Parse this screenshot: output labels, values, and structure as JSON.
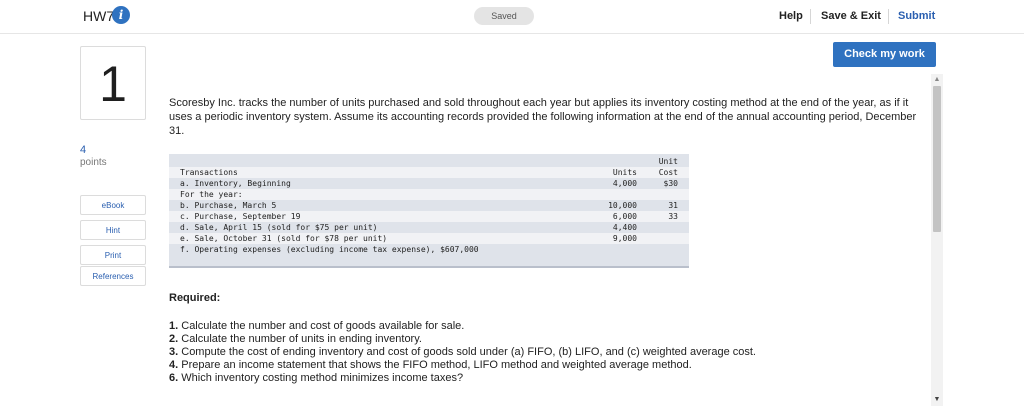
{
  "header": {
    "title": "HW7",
    "info_glyph": "i",
    "saved_label": "Saved",
    "help_label": "Help",
    "save_exit_label": "Save & Exit",
    "submit_label": "Submit"
  },
  "check_work_label": "Check my work",
  "question": {
    "number": "1",
    "points_value": "4",
    "points_label": "points",
    "text": "Scoresby Inc. tracks the number of units purchased and sold throughout each year but applies its inventory costing method at the end of the year, as if it uses a periodic inventory system. Assume its accounting records provided the following information at the end of the annual accounting period, December 31."
  },
  "sidebar": {
    "ebook": "eBook",
    "hint": "Hint",
    "print": "Print",
    "references": "References"
  },
  "table": {
    "header_unit": "Unit",
    "header_transactions": "Transactions",
    "header_units": "Units",
    "header_cost": "Cost",
    "rows": [
      {
        "desc": "a. Inventory, Beginning",
        "units": "4,000",
        "cost": "$30"
      },
      {
        "desc": "For the year:",
        "units": "",
        "cost": ""
      },
      {
        "desc": "b. Purchase, March 5",
        "units": "10,000",
        "cost": "31"
      },
      {
        "desc": "c. Purchase, September 19",
        "units": "6,000",
        "cost": "33"
      },
      {
        "desc": "d. Sale, April 15 (sold for $75 per unit)",
        "units": "4,400",
        "cost": ""
      },
      {
        "desc": "e. Sale, October 31 (sold for $78 per unit)",
        "units": "9,000",
        "cost": ""
      },
      {
        "desc": "f. Operating expenses (excluding income tax expense), $607,000",
        "units": "",
        "cost": ""
      }
    ]
  },
  "required": {
    "heading": "Required:",
    "items": [
      {
        "num": "1.",
        "text": " Calculate the number and cost of goods available for sale."
      },
      {
        "num": "2.",
        "text": " Calculate the number of units in ending inventory."
      },
      {
        "num": "3.",
        "text": " Compute the cost of ending inventory and cost of goods sold under (a) FIFO, (b) LIFO, and (c) weighted average cost."
      },
      {
        "num": "4.",
        "text": " Prepare an income statement that shows the FIFO method, LIFO method and weighted average method."
      },
      {
        "num": "6.",
        "text": " Which inventory costing method minimizes income taxes?"
      }
    ]
  },
  "scrollbar": {
    "up_glyph": "▲",
    "down_glyph": "▼"
  },
  "colors": {
    "accent": "#2f72c0",
    "table_bg": "#dfe3ea",
    "table_row_light": "#f1f2f5"
  }
}
